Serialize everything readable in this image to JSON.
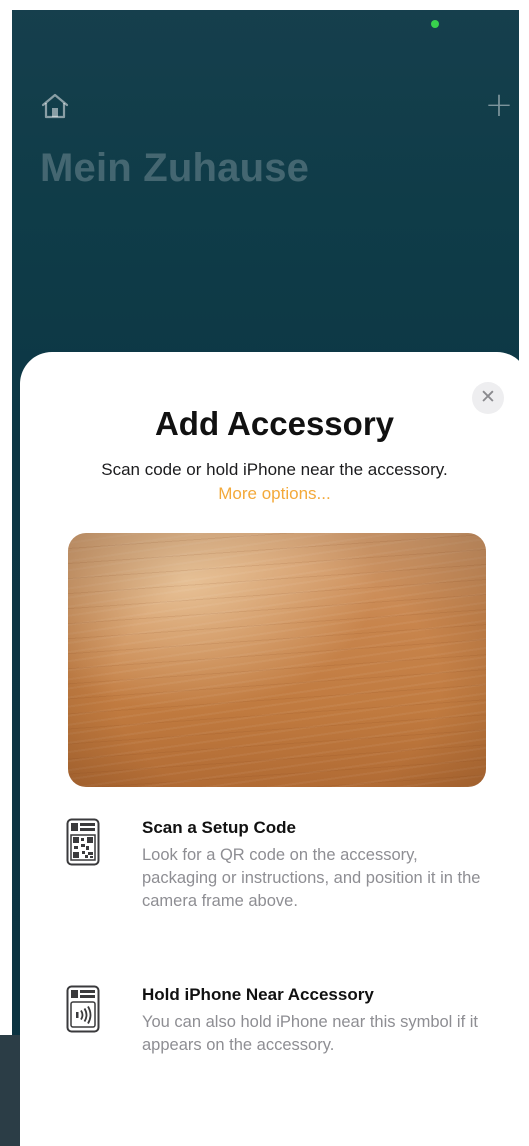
{
  "status": {
    "indicator_color": "#38d04d"
  },
  "home": {
    "title": "Mein Zuhause",
    "home_icon": "house-icon",
    "add_icon": "plus-icon"
  },
  "sheet": {
    "title": "Add Accessory",
    "subtitle": "Scan code or hold iPhone near the accessory.",
    "more_link": "More options...",
    "close_icon": "close-icon",
    "close_glyph": "✕",
    "accent_color": "#f3a93a"
  },
  "options": [
    {
      "icon": "qr-code-icon",
      "title": "Scan a Setup Code",
      "description": "Look for a QR code on the accessory, packaging or instructions, and position it in the camera frame above."
    },
    {
      "icon": "nfc-tag-icon",
      "title": "Hold iPhone Near Accessory",
      "description": "You can also hold iPhone near this symbol if it appears on the accessory."
    }
  ]
}
